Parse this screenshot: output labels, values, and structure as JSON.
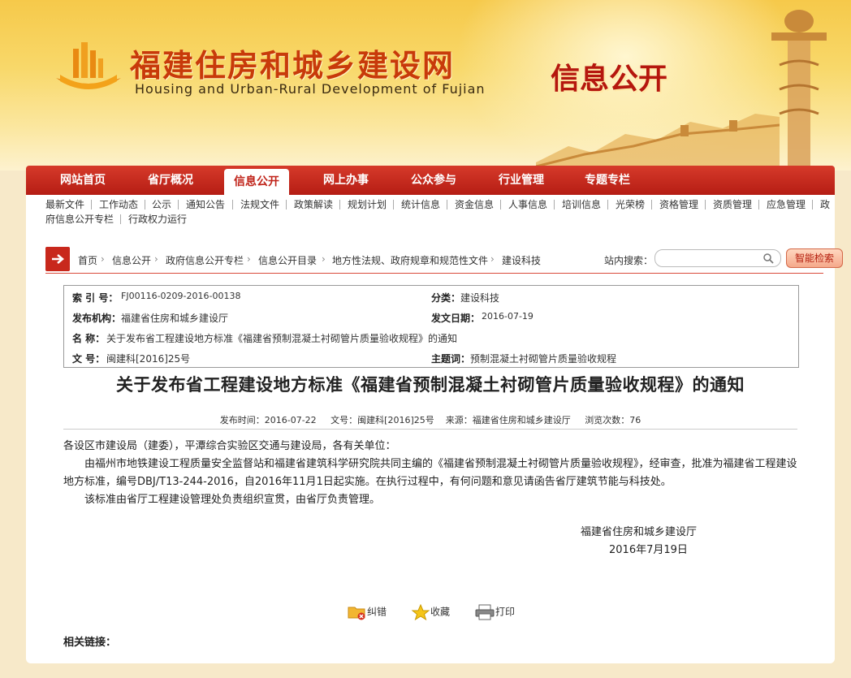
{
  "header": {
    "site_title": "福建住房和城乡建设网",
    "site_subtitle": "Housing and Urban-Rural Development of Fujian",
    "section_title": "信息公开"
  },
  "nav": {
    "tabs": [
      "网站首页",
      "省厅概况",
      "信息公开",
      "网上办事",
      "公众参与",
      "行业管理",
      "专题专栏"
    ],
    "active": "信息公开"
  },
  "subnav": {
    "row1": [
      "最新文件",
      "工作动态",
      "公示",
      "通知公告",
      "法规文件",
      "政策解读",
      "规划计划",
      "统计信息",
      "资金信息",
      "人事信息",
      "培训信息",
      "光荣榜",
      "资格管理",
      "资质管理",
      "应急管理",
      "政"
    ],
    "row2": [
      "府信息公开专栏",
      "行政权力运行"
    ]
  },
  "breadcrumb": {
    "items": [
      "首页",
      "信息公开",
      "政府信息公开专栏",
      "信息公开目录",
      "地方性法规、政府规章和规范性文件",
      "建设科技"
    ],
    "separator": "›"
  },
  "search": {
    "label": "站内搜索：",
    "placeholder": "",
    "advanced_label": "智能检索"
  },
  "meta": {
    "index_key": "索 引 号：",
    "index_val": "FJ00116-0209-2016-00138",
    "category_key": "分类：",
    "category_val": "建设科技",
    "publisher_key": "发布机构：",
    "publisher_val": "福建省住房和城乡建设厅",
    "date_key": "发文日期：",
    "date_val": "2016-07-19",
    "name_key": "名 称：",
    "name_val": "关于发布省工程建设地方标准《福建省预制混凝土衬砌管片质量验收规程》的通知",
    "docno_key": "文 号：",
    "docno_val": "闽建科[2016]25号",
    "subject_key": "主题词：",
    "subject_val": "预制混凝土衬砌管片质量验收规程"
  },
  "article": {
    "title": "关于发布省工程建设地方标准《福建省预制混凝土衬砌管片质量验收规程》的通知",
    "pub_time_label": "发布时间：",
    "pub_time": "2016-07-22",
    "docno_label": "文号：",
    "docno": "闽建科[2016]25号",
    "source_label": "来源：",
    "source": "福建省住房和城乡建设厅",
    "views_label": "浏览次数：",
    "views": "76",
    "p1": "各设区市建设局（建委），平潭综合实验区交通与建设局，各有关单位：",
    "p2": "　　由福州市地铁建设工程质量安全监督站和福建省建筑科学研究院共同主编的《福建省预制混凝土衬砌管片质量验收规程》，经审查，批准为福建省工程建设地方标准，编号DBJ/T13-244-2016，自2016年11月1日起实施。在执行过程中，有何问题和意见请函告省厅建筑节能与科技处。",
    "p3": "　　该标准由省厅工程建设管理处负责组织宣贯，由省厅负责管理。",
    "sign_org": "福建省住房和城乡建设厅",
    "sign_date": "2016年7月19日"
  },
  "actions": {
    "report": "纠错",
    "favorite": "收藏",
    "print": "打印"
  },
  "related_label": "相关链接：",
  "colors": {
    "nav_red": "#c0241a",
    "title_red": "#c83a0a",
    "banner_gold": "#f6c94a"
  }
}
